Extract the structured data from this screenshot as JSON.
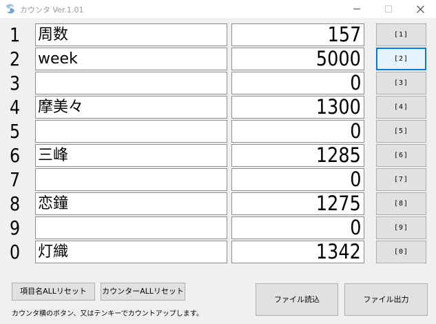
{
  "window": {
    "title": "カウンタ Ver.1.01",
    "icon": "app-logo-icon"
  },
  "rows": [
    {
      "number": "1",
      "name": "周数",
      "count": "157",
      "button": "[1]"
    },
    {
      "number": "2",
      "name": "week",
      "count": "5000",
      "button": "[2]"
    },
    {
      "number": "3",
      "name": "",
      "count": "0",
      "button": "[3]"
    },
    {
      "number": "4",
      "name": "摩美々",
      "count": "1300",
      "button": "[4]"
    },
    {
      "number": "5",
      "name": "",
      "count": "0",
      "button": "[5]"
    },
    {
      "number": "6",
      "name": "三峰",
      "count": "1285",
      "button": "[6]"
    },
    {
      "number": "7",
      "name": "",
      "count": "0",
      "button": "[7]"
    },
    {
      "number": "8",
      "name": "恋鐘",
      "count": "1275",
      "button": "[8]"
    },
    {
      "number": "9",
      "name": "",
      "count": "0",
      "button": "[9]"
    },
    {
      "number": "0",
      "name": "灯織",
      "count": "1342",
      "button": "[0]"
    }
  ],
  "focused_button": "[2]",
  "bottom": {
    "reset_names_label": "項目名ALLリセット",
    "reset_counters_label": "カウンターALLリセット",
    "load_file_label": "ファイル読込",
    "save_file_label": "ファイル出力",
    "hint": "カウンタ横のボタン、又はテンキーでカウントアップします。"
  },
  "colors": {
    "accent": "#0078d7",
    "background": "#f0f0f0",
    "button": "#e1e1e1"
  }
}
